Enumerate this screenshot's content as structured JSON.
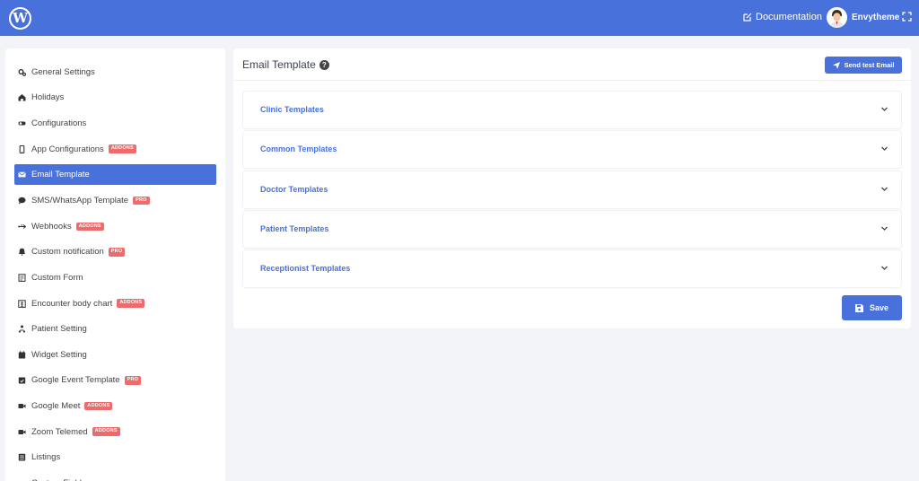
{
  "topbar": {
    "logo_glyph": "W",
    "documentation_label": "Documentation",
    "user_name": "Envytheme"
  },
  "sidebar": {
    "items": [
      {
        "label": "General Settings",
        "icon": "cogs-icon",
        "badge": ""
      },
      {
        "label": "Holidays",
        "icon": "home-icon",
        "badge": ""
      },
      {
        "label": "Configurations",
        "icon": "toggle-icon",
        "badge": ""
      },
      {
        "label": "App Configurations",
        "icon": "mobile-icon",
        "badge": "ADDONS"
      },
      {
        "label": "Email Template",
        "icon": "envelope-icon",
        "badge": "",
        "active": true
      },
      {
        "label": "SMS/WhatsApp Template",
        "icon": "comment-icon",
        "badge": "PRO"
      },
      {
        "label": "Webhooks",
        "icon": "usb-icon",
        "badge": "ADDONS"
      },
      {
        "label": "Custom notification",
        "icon": "bell-icon",
        "badge": "PRO"
      },
      {
        "label": "Custom Form",
        "icon": "form-icon",
        "badge": ""
      },
      {
        "label": "Encounter body chart",
        "icon": "body-chart-icon",
        "badge": "ADDONS"
      },
      {
        "label": "Patient Setting",
        "icon": "users-icon",
        "badge": ""
      },
      {
        "label": "Widget Setting",
        "icon": "calendar-icon",
        "badge": ""
      },
      {
        "label": "Google Event Template",
        "icon": "calendar-check-icon",
        "badge": "PRO"
      },
      {
        "label": "Google Meet",
        "icon": "video-icon",
        "badge": "ADDONS"
      },
      {
        "label": "Zoom Telemed",
        "icon": "video-icon",
        "badge": "ADDONS"
      },
      {
        "label": "Listings",
        "icon": "list-icon",
        "badge": ""
      },
      {
        "label": "Custom Field",
        "icon": "fields-icon",
        "badge": ""
      }
    ]
  },
  "main": {
    "title": "Email Template",
    "send_test_label": "Send test Email",
    "accordions": [
      {
        "label": "Clinic Templates"
      },
      {
        "label": "Common Templates"
      },
      {
        "label": "Doctor Templates"
      },
      {
        "label": "Patient Templates"
      },
      {
        "label": "Receptionist Templates"
      }
    ],
    "save_label": "Save"
  },
  "colors": {
    "brand": "#4871db",
    "badge": "#ef6a6a",
    "background": "#f3f4f8"
  }
}
